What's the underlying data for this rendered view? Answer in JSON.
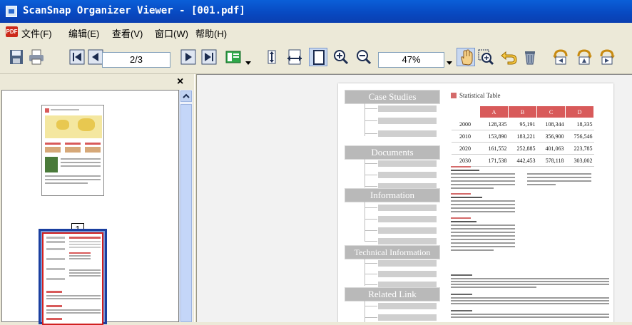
{
  "window": {
    "title": "ScanSnap Organizer Viewer - [001.pdf]"
  },
  "menu": [
    {
      "label": "文件(F)"
    },
    {
      "label": "编辑(E)"
    },
    {
      "label": "查看(V)"
    },
    {
      "label": "窗口(W)"
    },
    {
      "label": "帮助(H)"
    }
  ],
  "toolbar": {
    "page_value": "2/3",
    "zoom_value": "47%",
    "icons": [
      "save-icon",
      "print-icon",
      "first-page-icon",
      "previous-page-icon",
      "next-page-icon",
      "last-page-icon",
      "thumbnail-view-icon",
      "fit-height-icon",
      "fit-width-icon",
      "fit-page-icon",
      "zoom-in-icon",
      "zoom-out-icon",
      "hand-tool-icon",
      "zoom-area-icon",
      "undo-icon",
      "trash-icon",
      "rotate-left-icon",
      "rotate-180-icon",
      "rotate-right-icon"
    ]
  },
  "thumbnails": {
    "close": "×",
    "items": [
      {
        "label": "1"
      }
    ]
  },
  "document": {
    "nav_boxes": [
      "Case Studies",
      "Documents",
      "Information",
      "Technical Information",
      "Related Link"
    ],
    "stat_title": "Statistical Table",
    "headers": [
      "A",
      "B",
      "C",
      "D"
    ],
    "rows": [
      {
        "year": "2000",
        "values": [
          "128,335",
          "95,191",
          "108,344",
          "18,335"
        ]
      },
      {
        "year": "2010",
        "values": [
          "153,890",
          "183,221",
          "356,900",
          "756,546"
        ]
      },
      {
        "year": "2020",
        "values": [
          "161,552",
          "252,885",
          "401,063",
          "223,785"
        ]
      },
      {
        "year": "2030",
        "values": [
          "171,538",
          "442,453",
          "578,118",
          "303,002"
        ]
      }
    ]
  },
  "colors": {
    "titlebar": "#0a5fd8",
    "accent_red": "#d85a5a",
    "selection_blue": "#1a3fa0"
  }
}
